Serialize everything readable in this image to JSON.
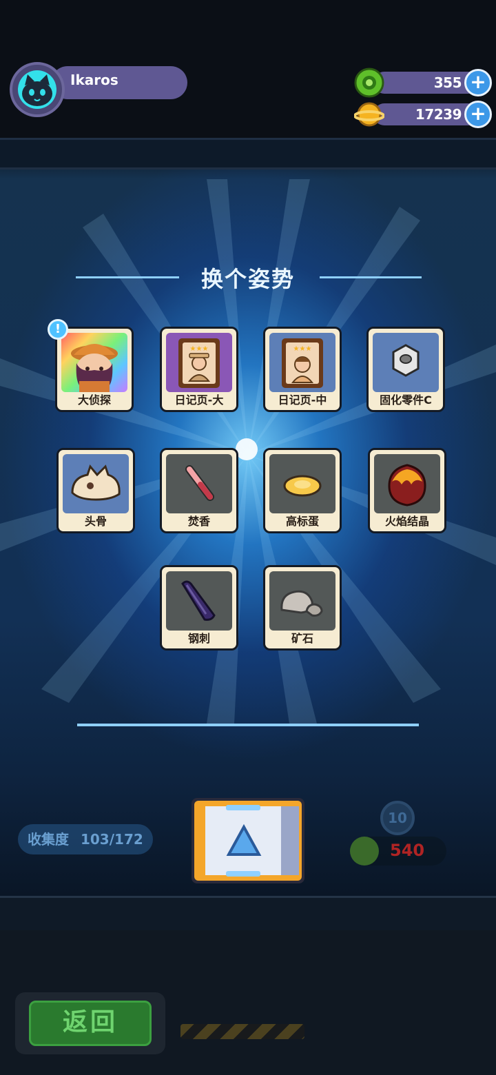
{
  "player": {
    "name": "Ikaros"
  },
  "currencies": [
    {
      "id": "green",
      "value": "355"
    },
    {
      "id": "gold",
      "value": "17239"
    }
  ],
  "panel": {
    "title": "换个姿势"
  },
  "items": [
    {
      "label": "大侦探",
      "style": "rainbow",
      "icon": "detective-icon",
      "badge": "!"
    },
    {
      "label": "日记页-大",
      "style": "purple",
      "icon": "diary-big-icon"
    },
    {
      "label": "日记页-中",
      "style": "blue",
      "icon": "diary-mid-icon"
    },
    {
      "label": "固化零件C",
      "style": "blue",
      "icon": "hex-nut-icon"
    },
    {
      "label": "头骨",
      "style": "blue",
      "icon": "skull-icon"
    },
    {
      "label": "焚香",
      "style": "gray",
      "icon": "incense-icon"
    },
    {
      "label": "高标蛋",
      "style": "gray",
      "icon": "fried-egg-icon"
    },
    {
      "label": "火焰结晶",
      "style": "gray",
      "icon": "flame-crystal-icon"
    },
    {
      "label": "钢刺",
      "style": "gray",
      "icon": "steel-spike-icon"
    },
    {
      "label": "矿石",
      "style": "gray",
      "icon": "ore-icon"
    }
  ],
  "collection": {
    "label": "收集度",
    "value": "103/172"
  },
  "machine": {
    "level": "10",
    "cost": "540"
  },
  "back_label": "返回"
}
